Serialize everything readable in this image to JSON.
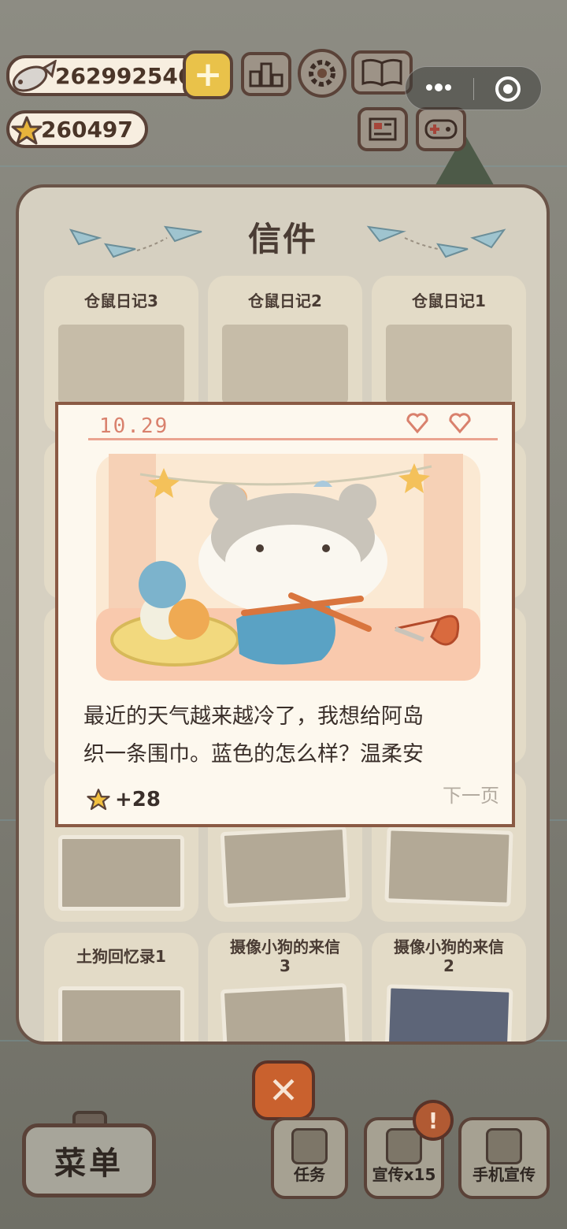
{
  "hud": {
    "fish_count": "262992546",
    "star_count": "260497"
  },
  "panel": {
    "title": "信件",
    "letters": [
      {
        "title": "仓鼠日记3"
      },
      {
        "title": "仓鼠日记2"
      },
      {
        "title": "仓鼠日记1"
      },
      {
        "title": "土狗回忆录1"
      },
      {
        "title": "摄像小狗的来信\n3"
      },
      {
        "title": "摄像小狗的来信\n2"
      }
    ]
  },
  "popup": {
    "date": "10.29",
    "text_line1": "最近的天气越来越冷了，我想给阿岛",
    "text_line2": "织一条围巾。蓝色的怎么样？温柔安",
    "reward": "+28",
    "next_label": "下一页"
  },
  "bottom": {
    "menu_label": "菜单",
    "task_label": "任务",
    "promote_label": "宣传x15",
    "phone_promote_label": "手机宣传",
    "alert_mark": "!"
  },
  "icons": {
    "fish": "fish-icon",
    "star": "star-icon",
    "plus": "plus-icon",
    "close": "close-icon"
  },
  "colors": {
    "accent_gold": "#e9c24a",
    "close_orange": "#c9612e",
    "letter_pink": "#d9816d",
    "border_brown": "#5a4238"
  }
}
